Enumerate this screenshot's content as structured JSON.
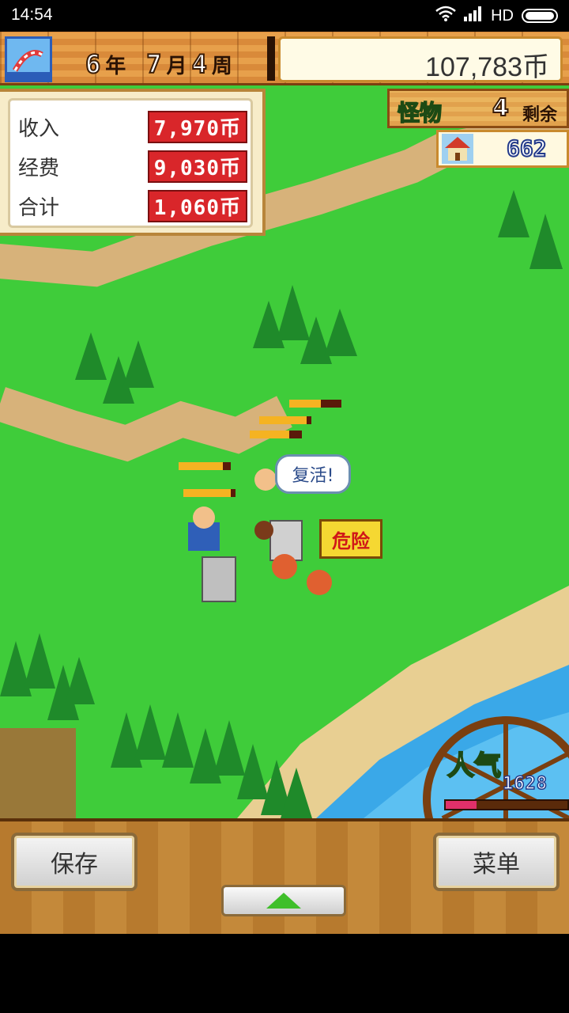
{
  "status_bar": {
    "time": "14:54",
    "network": "HD"
  },
  "header": {
    "year": "6",
    "year_unit": "年",
    "month": "7",
    "month_unit": "月",
    "week": "4",
    "week_unit": "周",
    "money": "107,783币"
  },
  "finance": {
    "income_label": "收入",
    "income_value": "7,970币",
    "expense_label": "经费",
    "expense_value": "9,030币",
    "total_label": "合计",
    "total_value": "1,060币"
  },
  "monsters": {
    "label": "怪物",
    "count": "4",
    "unit": "剩余"
  },
  "popularity_counter": "662",
  "speech_bubble": "复活!",
  "danger_sign": "危险",
  "gauge": {
    "label": "人气",
    "value": "1628",
    "fill_fraction": 0.25
  },
  "buttons": {
    "save": "保存",
    "menu": "菜单"
  },
  "colors": {
    "grass": "#3fcc3a",
    "path": "#d7b27a",
    "water": "#3aa8e8",
    "wood": "#b77a2e"
  }
}
